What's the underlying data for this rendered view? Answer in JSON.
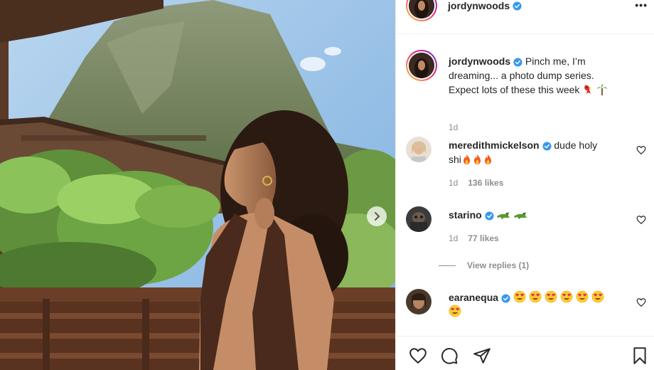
{
  "post": {
    "author": "jordynwoods",
    "author_verified": true,
    "more_label": "•••"
  },
  "caption": {
    "username": "jordynwoods",
    "text_line1": "Pinch me, I’m",
    "text_line2": "dreaming... a photo dump series.",
    "text_line3": "Expect lots of these this week",
    "emojis": [
      "parrot",
      "palm-tree"
    ],
    "time": "1d"
  },
  "comments": [
    {
      "username": "meredithmickelson",
      "verified": true,
      "text_line1": "dude holy",
      "text_line2": "shi",
      "emojis": [
        "fire",
        "fire",
        "fire"
      ],
      "time": "1d",
      "likes": "136 likes"
    },
    {
      "username": "starino",
      "verified": true,
      "text": "",
      "emojis": [
        "crocodile",
        "crocodile"
      ],
      "time": "1d",
      "likes": "77 likes",
      "view_replies": "View replies (1)"
    },
    {
      "username": "earanequa",
      "verified": true,
      "emojis": [
        "heart-eyes",
        "heart-eyes",
        "heart-eyes",
        "heart-eyes",
        "heart-eyes",
        "heart-eyes",
        "heart-eyes"
      ]
    }
  ],
  "actions": {
    "icons": [
      "heart-icon",
      "comment-icon",
      "share-icon",
      "bookmark-icon"
    ]
  },
  "colors": {
    "verified_blue": "#3897f0",
    "text_primary": "#262626",
    "text_secondary": "#8e8e8e",
    "divider": "#efefef"
  }
}
